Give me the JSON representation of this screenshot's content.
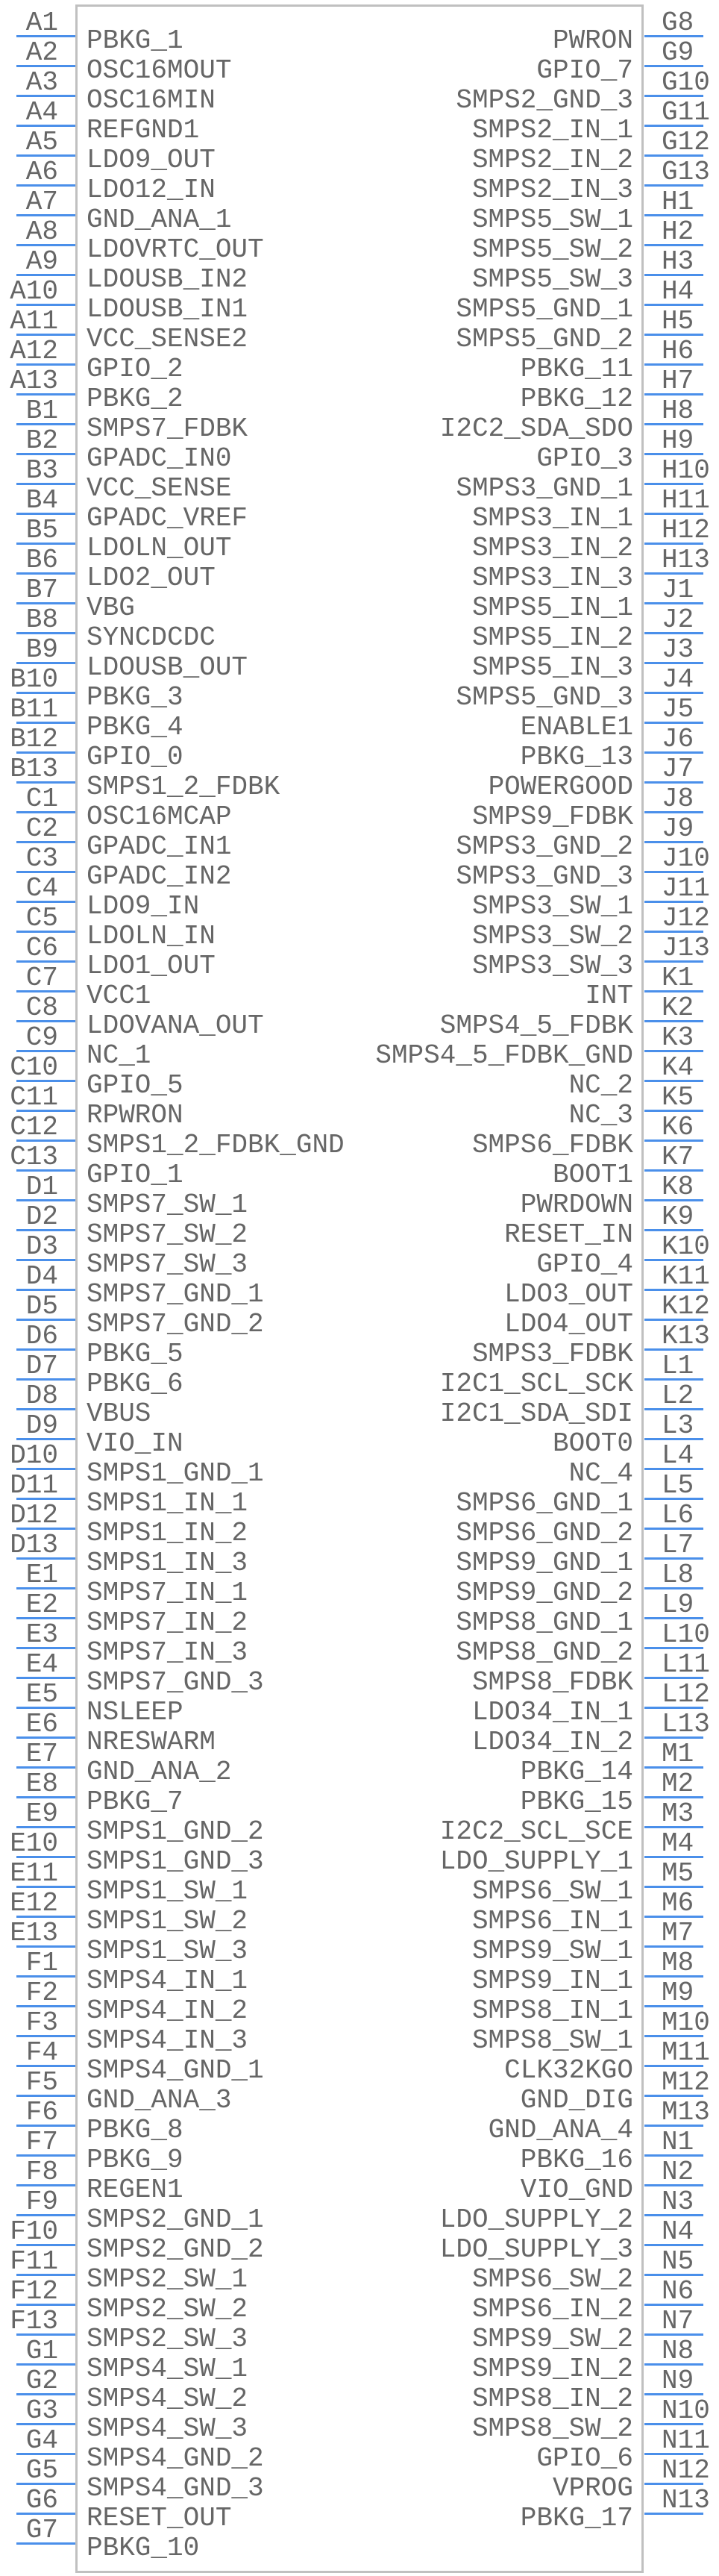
{
  "symbol": {
    "colors": {
      "pin_line": "#4a8fea",
      "body_outline": "#c0c0c0",
      "text": "#666666"
    },
    "left_pins": [
      {
        "number": "A1",
        "name": "PBKG_1"
      },
      {
        "number": "A2",
        "name": "OSC16MOUT"
      },
      {
        "number": "A3",
        "name": "OSC16MIN"
      },
      {
        "number": "A4",
        "name": "REFGND1"
      },
      {
        "number": "A5",
        "name": "LDO9_OUT"
      },
      {
        "number": "A6",
        "name": "LDO12_IN"
      },
      {
        "number": "A7",
        "name": "GND_ANA_1"
      },
      {
        "number": "A8",
        "name": "LDOVRTC_OUT"
      },
      {
        "number": "A9",
        "name": "LDOUSB_IN2"
      },
      {
        "number": "A10",
        "name": "LDOUSB_IN1"
      },
      {
        "number": "A11",
        "name": "VCC_SENSE2"
      },
      {
        "number": "A12",
        "name": "GPIO_2"
      },
      {
        "number": "A13",
        "name": "PBKG_2"
      },
      {
        "number": "B1",
        "name": "SMPS7_FDBK"
      },
      {
        "number": "B2",
        "name": "GPADC_IN0"
      },
      {
        "number": "B3",
        "name": "VCC_SENSE"
      },
      {
        "number": "B4",
        "name": "GPADC_VREF"
      },
      {
        "number": "B5",
        "name": "LDOLN_OUT"
      },
      {
        "number": "B6",
        "name": "LDO2_OUT"
      },
      {
        "number": "B7",
        "name": "VBG"
      },
      {
        "number": "B8",
        "name": "SYNCDCDC"
      },
      {
        "number": "B9",
        "name": "LDOUSB_OUT"
      },
      {
        "number": "B10",
        "name": "PBKG_3"
      },
      {
        "number": "B11",
        "name": "PBKG_4"
      },
      {
        "number": "B12",
        "name": "GPIO_0"
      },
      {
        "number": "B13",
        "name": "SMPS1_2_FDBK"
      },
      {
        "number": "C1",
        "name": "OSC16MCAP"
      },
      {
        "number": "C2",
        "name": "GPADC_IN1"
      },
      {
        "number": "C3",
        "name": "GPADC_IN2"
      },
      {
        "number": "C4",
        "name": "LDO9_IN"
      },
      {
        "number": "C5",
        "name": "LDOLN_IN"
      },
      {
        "number": "C6",
        "name": "LDO1_OUT"
      },
      {
        "number": "C7",
        "name": "VCC1"
      },
      {
        "number": "C8",
        "name": "LDOVANA_OUT"
      },
      {
        "number": "C9",
        "name": "NC_1"
      },
      {
        "number": "C10",
        "name": "GPIO_5"
      },
      {
        "number": "C11",
        "name": "RPWRON"
      },
      {
        "number": "C12",
        "name": "SMPS1_2_FDBK_GND"
      },
      {
        "number": "C13",
        "name": "GPIO_1"
      },
      {
        "number": "D1",
        "name": "SMPS7_SW_1"
      },
      {
        "number": "D2",
        "name": "SMPS7_SW_2"
      },
      {
        "number": "D3",
        "name": "SMPS7_SW_3"
      },
      {
        "number": "D4",
        "name": "SMPS7_GND_1"
      },
      {
        "number": "D5",
        "name": "SMPS7_GND_2"
      },
      {
        "number": "D6",
        "name": "PBKG_5"
      },
      {
        "number": "D7",
        "name": "PBKG_6"
      },
      {
        "number": "D8",
        "name": "VBUS"
      },
      {
        "number": "D9",
        "name": "VIO_IN"
      },
      {
        "number": "D10",
        "name": "SMPS1_GND_1"
      },
      {
        "number": "D11",
        "name": "SMPS1_IN_1"
      },
      {
        "number": "D12",
        "name": "SMPS1_IN_2"
      },
      {
        "number": "D13",
        "name": "SMPS1_IN_3"
      },
      {
        "number": "E1",
        "name": "SMPS7_IN_1"
      },
      {
        "number": "E2",
        "name": "SMPS7_IN_2"
      },
      {
        "number": "E3",
        "name": "SMPS7_IN_3"
      },
      {
        "number": "E4",
        "name": "SMPS7_GND_3"
      },
      {
        "number": "E5",
        "name": "NSLEEP"
      },
      {
        "number": "E6",
        "name": "NRESWARM"
      },
      {
        "number": "E7",
        "name": "GND_ANA_2"
      },
      {
        "number": "E8",
        "name": "PBKG_7"
      },
      {
        "number": "E9",
        "name": "SMPS1_GND_2"
      },
      {
        "number": "E10",
        "name": "SMPS1_GND_3"
      },
      {
        "number": "E11",
        "name": "SMPS1_SW_1"
      },
      {
        "number": "E12",
        "name": "SMPS1_SW_2"
      },
      {
        "number": "E13",
        "name": "SMPS1_SW_3"
      },
      {
        "number": "F1",
        "name": "SMPS4_IN_1"
      },
      {
        "number": "F2",
        "name": "SMPS4_IN_2"
      },
      {
        "number": "F3",
        "name": "SMPS4_IN_3"
      },
      {
        "number": "F4",
        "name": "SMPS4_GND_1"
      },
      {
        "number": "F5",
        "name": "GND_ANA_3"
      },
      {
        "number": "F6",
        "name": "PBKG_8"
      },
      {
        "number": "F7",
        "name": "PBKG_9"
      },
      {
        "number": "F8",
        "name": "REGEN1"
      },
      {
        "number": "F9",
        "name": "SMPS2_GND_1"
      },
      {
        "number": "F10",
        "name": "SMPS2_GND_2"
      },
      {
        "number": "F11",
        "name": "SMPS2_SW_1"
      },
      {
        "number": "F12",
        "name": "SMPS2_SW_2"
      },
      {
        "number": "F13",
        "name": "SMPS2_SW_3"
      },
      {
        "number": "G1",
        "name": "SMPS4_SW_1"
      },
      {
        "number": "G2",
        "name": "SMPS4_SW_2"
      },
      {
        "number": "G3",
        "name": "SMPS4_SW_3"
      },
      {
        "number": "G4",
        "name": "SMPS4_GND_2"
      },
      {
        "number": "G5",
        "name": "SMPS4_GND_3"
      },
      {
        "number": "G6",
        "name": "RESET_OUT"
      },
      {
        "number": "G7",
        "name": "PBKG_10"
      }
    ],
    "right_pins": [
      {
        "number": "G8",
        "name": "PWRON"
      },
      {
        "number": "G9",
        "name": "GPIO_7"
      },
      {
        "number": "G10",
        "name": "SMPS2_GND_3"
      },
      {
        "number": "G11",
        "name": "SMPS2_IN_1"
      },
      {
        "number": "G12",
        "name": "SMPS2_IN_2"
      },
      {
        "number": "G13",
        "name": "SMPS2_IN_3"
      },
      {
        "number": "H1",
        "name": "SMPS5_SW_1"
      },
      {
        "number": "H2",
        "name": "SMPS5_SW_2"
      },
      {
        "number": "H3",
        "name": "SMPS5_SW_3"
      },
      {
        "number": "H4",
        "name": "SMPS5_GND_1"
      },
      {
        "number": "H5",
        "name": "SMPS5_GND_2"
      },
      {
        "number": "H6",
        "name": "PBKG_11"
      },
      {
        "number": "H7",
        "name": "PBKG_12"
      },
      {
        "number": "H8",
        "name": "I2C2_SDA_SDO"
      },
      {
        "number": "H9",
        "name": "GPIO_3"
      },
      {
        "number": "H10",
        "name": "SMPS3_GND_1"
      },
      {
        "number": "H11",
        "name": "SMPS3_IN_1"
      },
      {
        "number": "H12",
        "name": "SMPS3_IN_2"
      },
      {
        "number": "H13",
        "name": "SMPS3_IN_3"
      },
      {
        "number": "J1",
        "name": "SMPS5_IN_1"
      },
      {
        "number": "J2",
        "name": "SMPS5_IN_2"
      },
      {
        "number": "J3",
        "name": "SMPS5_IN_3"
      },
      {
        "number": "J4",
        "name": "SMPS5_GND_3"
      },
      {
        "number": "J5",
        "name": "ENABLE1"
      },
      {
        "number": "J6",
        "name": "PBKG_13"
      },
      {
        "number": "J7",
        "name": "POWERGOOD"
      },
      {
        "number": "J8",
        "name": "SMPS9_FDBK"
      },
      {
        "number": "J9",
        "name": "SMPS3_GND_2"
      },
      {
        "number": "J10",
        "name": "SMPS3_GND_3"
      },
      {
        "number": "J11",
        "name": "SMPS3_SW_1"
      },
      {
        "number": "J12",
        "name": "SMPS3_SW_2"
      },
      {
        "number": "J13",
        "name": "SMPS3_SW_3"
      },
      {
        "number": "K1",
        "name": "INT"
      },
      {
        "number": "K2",
        "name": "SMPS4_5_FDBK"
      },
      {
        "number": "K3",
        "name": "SMPS4_5_FDBK_GND"
      },
      {
        "number": "K4",
        "name": "NC_2"
      },
      {
        "number": "K5",
        "name": "NC_3"
      },
      {
        "number": "K6",
        "name": "SMPS6_FDBK"
      },
      {
        "number": "K7",
        "name": "BOOT1"
      },
      {
        "number": "K8",
        "name": "PWRDOWN"
      },
      {
        "number": "K9",
        "name": "RESET_IN"
      },
      {
        "number": "K10",
        "name": "GPIO_4"
      },
      {
        "number": "K11",
        "name": "LDO3_OUT"
      },
      {
        "number": "K12",
        "name": "LDO4_OUT"
      },
      {
        "number": "K13",
        "name": "SMPS3_FDBK"
      },
      {
        "number": "L1",
        "name": "I2C1_SCL_SCK"
      },
      {
        "number": "L2",
        "name": "I2C1_SDA_SDI"
      },
      {
        "number": "L3",
        "name": "BOOT0"
      },
      {
        "number": "L4",
        "name": "NC_4"
      },
      {
        "number": "L5",
        "name": "SMPS6_GND_1"
      },
      {
        "number": "L6",
        "name": "SMPS6_GND_2"
      },
      {
        "number": "L7",
        "name": "SMPS9_GND_1"
      },
      {
        "number": "L8",
        "name": "SMPS9_GND_2"
      },
      {
        "number": "L9",
        "name": "SMPS8_GND_1"
      },
      {
        "number": "L10",
        "name": "SMPS8_GND_2"
      },
      {
        "number": "L11",
        "name": "SMPS8_FDBK"
      },
      {
        "number": "L12",
        "name": "LDO34_IN_1"
      },
      {
        "number": "L13",
        "name": "LDO34_IN_2"
      },
      {
        "number": "M1",
        "name": "PBKG_14"
      },
      {
        "number": "M2",
        "name": "PBKG_15"
      },
      {
        "number": "M3",
        "name": "I2C2_SCL_SCE"
      },
      {
        "number": "M4",
        "name": "LDO_SUPPLY_1"
      },
      {
        "number": "M5",
        "name": "SMPS6_SW_1"
      },
      {
        "number": "M6",
        "name": "SMPS6_IN_1"
      },
      {
        "number": "M7",
        "name": "SMPS9_SW_1"
      },
      {
        "number": "M8",
        "name": "SMPS9_IN_1"
      },
      {
        "number": "M9",
        "name": "SMPS8_IN_1"
      },
      {
        "number": "M10",
        "name": "SMPS8_SW_1"
      },
      {
        "number": "M11",
        "name": "CLK32KGO"
      },
      {
        "number": "M12",
        "name": "GND_DIG"
      },
      {
        "number": "M13",
        "name": "GND_ANA_4"
      },
      {
        "number": "N1",
        "name": "PBKG_16"
      },
      {
        "number": "N2",
        "name": "VIO_GND"
      },
      {
        "number": "N3",
        "name": "LDO_SUPPLY_2"
      },
      {
        "number": "N4",
        "name": "LDO_SUPPLY_3"
      },
      {
        "number": "N5",
        "name": "SMPS6_SW_2"
      },
      {
        "number": "N6",
        "name": "SMPS6_IN_2"
      },
      {
        "number": "N7",
        "name": "SMPS9_SW_2"
      },
      {
        "number": "N8",
        "name": "SMPS9_IN_2"
      },
      {
        "number": "N9",
        "name": "SMPS8_IN_2"
      },
      {
        "number": "N10",
        "name": "SMPS8_SW_2"
      },
      {
        "number": "N11",
        "name": "GPIO_6"
      },
      {
        "number": "N12",
        "name": "VPROG"
      },
      {
        "number": "N13",
        "name": "PBKG_17"
      }
    ]
  }
}
